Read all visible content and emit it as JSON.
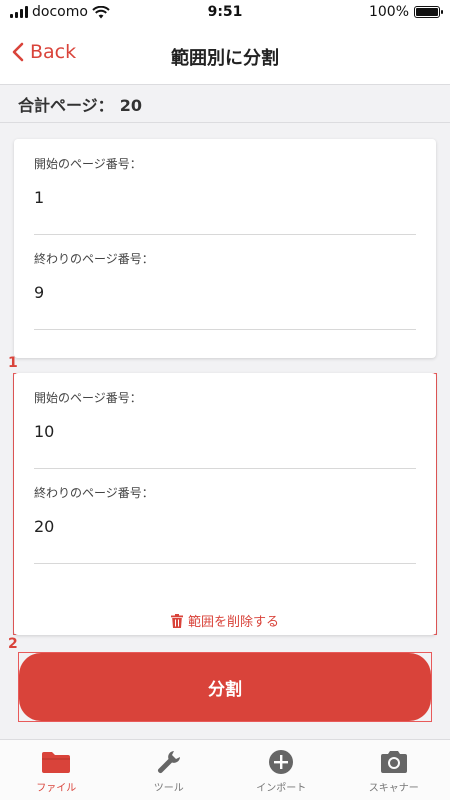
{
  "status_bar": {
    "carrier": "docomo",
    "time": "9:51",
    "battery": "100%"
  },
  "nav": {
    "back_label": "Back",
    "title": "範囲別に分割"
  },
  "total": {
    "label": "合計ページ：",
    "value": "20"
  },
  "ranges": [
    {
      "start_label": "開始のページ番号：",
      "start_value": "1",
      "end_label": "終わりのページ番号：",
      "end_value": "9"
    },
    {
      "start_label": "開始のページ番号：",
      "start_value": "10",
      "end_label": "終わりのページ番号：",
      "end_value": "20",
      "delete_label": "範囲を削除する"
    }
  ],
  "markers": {
    "one": "1",
    "two": "2"
  },
  "split_button_label": "分割",
  "tabs": [
    {
      "label": "ファイル",
      "icon": "folder-icon",
      "active": true
    },
    {
      "label": "ツール",
      "icon": "wrench-icon",
      "active": false
    },
    {
      "label": "インポート",
      "icon": "plus-circle-icon",
      "active": false
    },
    {
      "label": "スキャナー",
      "icon": "camera-icon",
      "active": false
    }
  ],
  "colors": {
    "accent": "#d9433a",
    "highlight": "#e85a5a",
    "background": "#f2f2f4"
  }
}
